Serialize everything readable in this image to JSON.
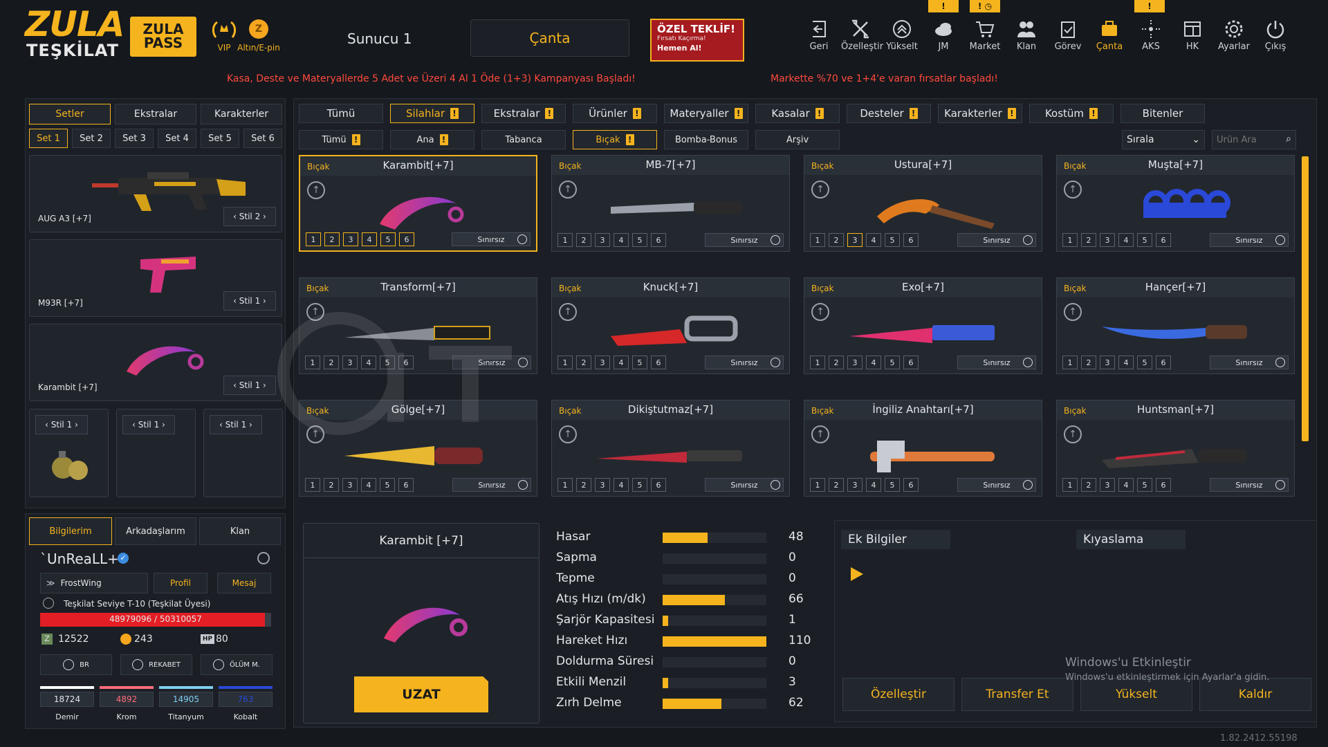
{
  "header": {
    "logo_line1": "ZULA",
    "logo_line2": "TEŞKİLAT",
    "pass_line1": "ZULA",
    "pass_line2": "PASS",
    "vip_label": "VIP",
    "altin_label": "Altın/E-pin",
    "server": "Sunucu 1",
    "bag_button": "Çanta",
    "offer_title": "ÖZEL TEKLİF!",
    "offer_subtitle": "Fırsatı Kaçırma!",
    "offer_cta": "Hemen Al!",
    "nav": [
      {
        "label": "Geri",
        "icon": "back-icon"
      },
      {
        "label": "Özelleştir",
        "icon": "tools-icon"
      },
      {
        "label": "Yükselt",
        "icon": "upgrade-icon"
      },
      {
        "label": "JM",
        "icon": "cloud-icon"
      },
      {
        "label": "Market",
        "icon": "cart-icon"
      },
      {
        "label": "Klan",
        "icon": "clan-icon"
      },
      {
        "label": "Görev",
        "icon": "clipboard-icon"
      },
      {
        "label": "Çanta",
        "icon": "bag-icon"
      },
      {
        "label": "AKS",
        "icon": "crosshair-icon"
      },
      {
        "label": "HK",
        "icon": "window-icon"
      },
      {
        "label": "Ayarlar",
        "icon": "gear-icon"
      },
      {
        "label": "Çıkış",
        "icon": "power-icon"
      }
    ],
    "badge_yukselt": "!",
    "badge_market": "!",
    "badge_aks": "!",
    "banner_left": "Kasa, Deste ve Materyallerde 5 Adet ve Üzeri 4 Al 1 Öde (1+3) Kampanyası Başladı!",
    "banner_right": "Markette %70 ve 1+4'e varan fırsatlar başladı!"
  },
  "left": {
    "tabs": [
      "Setler",
      "Ekstralar",
      "Karakterler"
    ],
    "sets": [
      "Set 1",
      "Set 2",
      "Set 3",
      "Set 4",
      "Set 5",
      "Set 6"
    ],
    "weapons": [
      {
        "name": "AUG A3 [+7]",
        "style": "Stil 2"
      },
      {
        "name": "M93R [+7]",
        "style": "Stil 1"
      },
      {
        "name": "Karambit [+7]",
        "style": "Stil 1"
      }
    ],
    "mini_styles": [
      "Stil 1",
      "Stil 1",
      "Stil 1"
    ]
  },
  "profile": {
    "tabs": [
      "Bilgilerim",
      "Arkadaşlarım",
      "Klan"
    ],
    "username": "`UnReaLL+",
    "rank_name": "FrostWing",
    "profile_btn": "Profil",
    "message_btn": "Mesaj",
    "level_text": "Teşkilat Seviye T-10 (Teşkilat Üyesi)",
    "xp_current": "48979096",
    "xp_total": "/ 50310057",
    "xp_progress": 0.973,
    "zcoin": "12522",
    "gold": "243",
    "hp": "80",
    "hp_label": "HP",
    "mode_buttons": [
      "BR",
      "REKABET",
      "ÖLÜM M."
    ],
    "materials": [
      {
        "value": "18724",
        "name": "Demir",
        "color": "#ffffff"
      },
      {
        "value": "4892",
        "name": "Krom",
        "color": "#ff6b7a"
      },
      {
        "value": "14905",
        "name": "Titanyum",
        "color": "#7fd0f0"
      },
      {
        "value": "763",
        "name": "Kobalt",
        "color": "#2a49d8"
      }
    ]
  },
  "categories": [
    "Tümü",
    "Silahlar",
    "Ekstralar",
    "Ürünler",
    "Materyaller",
    "Kasalar",
    "Desteler",
    "Karakterler",
    "Kostüm",
    "Bitenler"
  ],
  "subcategories": [
    "Tümü",
    "Ana",
    "Tabanca",
    "Bıçak",
    "Bomba-Bonus",
    "Arşiv"
  ],
  "sort_label": "Sırala",
  "search_placeholder": "Ürün Ara",
  "item_category": "Bıçak",
  "limit_label": "Sınırsız",
  "levels": [
    "1",
    "2",
    "3",
    "4",
    "5",
    "6"
  ],
  "items": [
    {
      "name": "Karambit[+7]",
      "art": "karambit"
    },
    {
      "name": "MB-7[+7]",
      "art": "combat"
    },
    {
      "name": "Ustura[+7]",
      "art": "razor"
    },
    {
      "name": "Muşta[+7]",
      "art": "knuckles"
    },
    {
      "name": "Transform[+7]",
      "art": "transform"
    },
    {
      "name": "Knuck[+7]",
      "art": "knuck"
    },
    {
      "name": "Exo[+7]",
      "art": "exo"
    },
    {
      "name": "Hançer[+7]",
      "art": "dagger"
    },
    {
      "name": "Gölge[+7]",
      "art": "golge"
    },
    {
      "name": "Dikiştutmaz[+7]",
      "art": "dikis"
    },
    {
      "name": "İngiliz Anahtarı[+7]",
      "art": "wrench"
    },
    {
      "name": "Huntsman[+7]",
      "art": "huntsman"
    }
  ],
  "preview": {
    "title": "Karambit [+7]",
    "extend_button": "UZAT"
  },
  "stats": [
    {
      "label": "Hasar",
      "value": 48
    },
    {
      "label": "Sapma",
      "value": 0
    },
    {
      "label": "Tepme",
      "value": 0
    },
    {
      "label": "Atış Hızı (m/dk)",
      "value": 66
    },
    {
      "label": "Şarjör Kapasitesi",
      "value": 1
    },
    {
      "label": "Hareket Hızı",
      "value": 110
    },
    {
      "label": "Doldurma Süresi",
      "value": 0
    },
    {
      "label": "Etkili Menzil",
      "value": 3
    },
    {
      "label": "Zırh Delme",
      "value": 62
    }
  ],
  "info": {
    "tab1": "Ek Bilgiler",
    "tab2": "Kıyaslama",
    "actions": [
      "Özelleştir",
      "Transfer Et",
      "Yükselt",
      "Kaldır"
    ]
  },
  "activation": {
    "title": "Windows'u Etkinleştir",
    "subtitle": "Windows'u etkinleştirmek için Ayarlar'a gidin."
  },
  "version": "1.82.2412.55198",
  "colors": {
    "accent": "#f5b41e",
    "banner": "#ff4a3d",
    "offer": "#a51b1f"
  }
}
